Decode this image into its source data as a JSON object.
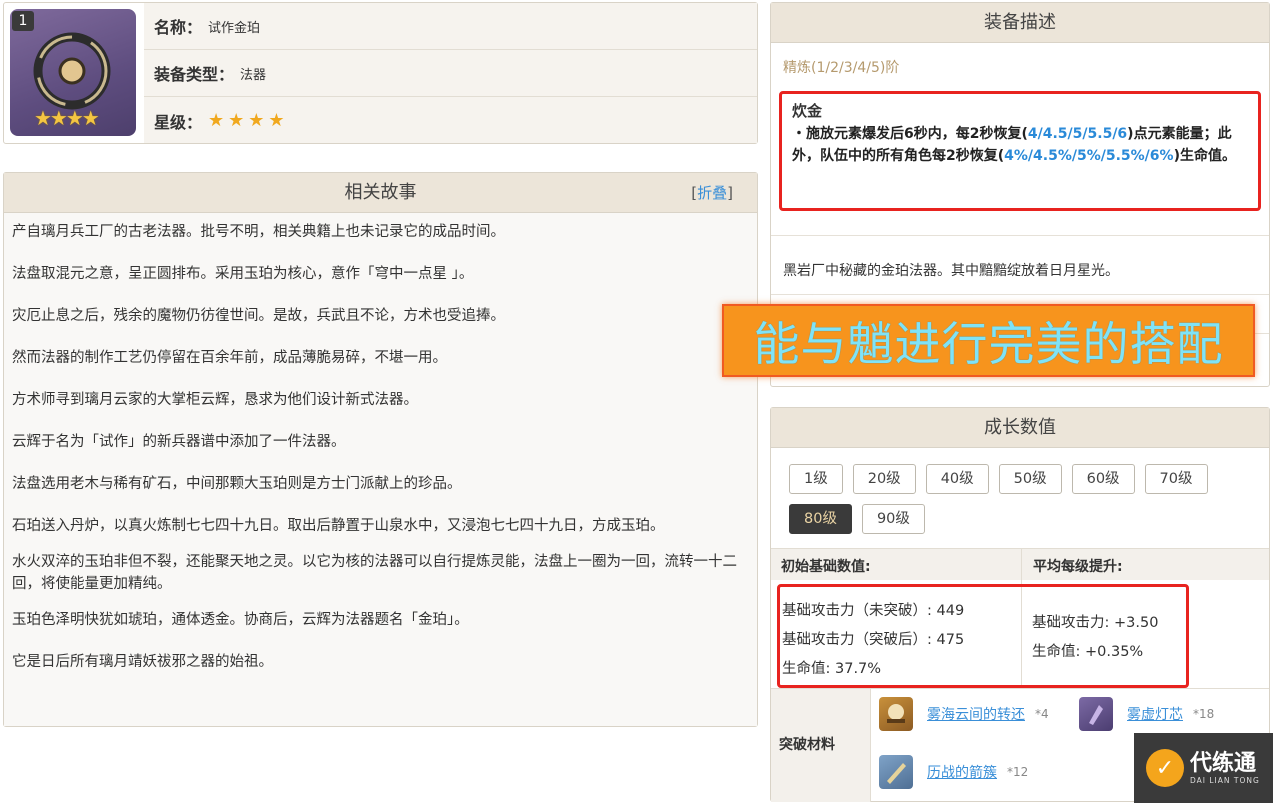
{
  "info": {
    "level_badge": "1",
    "thumb_stars": "★★★★",
    "name_key": "名称：",
    "name_val": "试作金珀",
    "type_key": "装备类型：",
    "type_val": "法器",
    "rarity_key": "星级：",
    "rarity_val": "★★★★"
  },
  "story": {
    "title": "相关故事",
    "fold_label": "折叠",
    "paragraphs": [
      "产自璃月兵工厂的古老法器。批号不明，相关典籍上也未记录它的成品时间。",
      "法盘取混元之意，呈正圆排布。采用玉珀为核心，意作「穹中一点星 」。",
      "灾厄止息之后，残余的魔物仍彷徨世间。是故，兵武且不论，方术也受追捧。",
      "然而法器的制作工艺仍停留在百余年前，成品薄脆易碎，不堪一用。",
      "方术师寻到璃月云家的大掌柜云辉，恳求为他们设计新式法器。",
      "云辉于名为「试作」的新兵器谱中添加了一件法器。",
      "法盘选用老木与稀有矿石，中间那颗大玉珀则是方士门派献上的珍品。",
      "石珀送入丹炉，以真火炼制七七四十九日。取出后静置于山泉水中，又浸泡七七四十九日，方成玉珀。",
      "水火双淬的玉珀非但不裂，还能聚天地之灵。以它为核的法器可以自行提炼灵能，法盘上一圈为一回，流转一十二回，将使能量更加精纯。",
      "玉珀色泽明快犹如琥珀，通体透金。协商后，云辉为法器题名「金珀」。",
      "它是日后所有璃月靖妖祓邪之器的始祖。"
    ]
  },
  "desc": {
    "title": "装备描述",
    "refine": "精炼(1/2/3/4/5)阶",
    "effect_name": "炊金",
    "effect_p1": "・施放元素爆发后6秒内，每2秒恢复(",
    "effect_h1": "4/4.5/5/5.5/6",
    "effect_p2": ")点元素能量；此外，队伍中的所有角色每2秒恢复(",
    "effect_h2": "4%/4.5%/5%/5.5%/6%",
    "effect_p3": ")生命值。",
    "flavor": "黑岩厂中秘藏的金珀法器。其中黯黯绽放着日月星光。"
  },
  "banner": "能与魈进行完美的搭配",
  "growth": {
    "title": "成长数值",
    "levels": [
      "1级",
      "20级",
      "40级",
      "50级",
      "60级",
      "70级",
      "80级",
      "90级"
    ],
    "active_level": "80级",
    "base_head": "初始基础数值:",
    "avg_head": "平均每级提升:",
    "base_atk": "基础攻击力（未突破）: 449",
    "base_atk_asc": "基础攻击力（突破后）: 475",
    "base_hp": "生命值: 37.7%",
    "avg_atk": "基础攻击力: +3.50",
    "avg_hp": "生命值: +0.35%",
    "mat_label": "突破材料",
    "materials": [
      {
        "name": "雾海云间的转还",
        "count": "*4"
      },
      {
        "name": "雾虚灯芯",
        "count": "*18"
      },
      {
        "name": "历战的箭簇",
        "count": "*12"
      }
    ]
  },
  "logo": {
    "cn": "代练通",
    "en": "DAI LIAN TONG"
  }
}
